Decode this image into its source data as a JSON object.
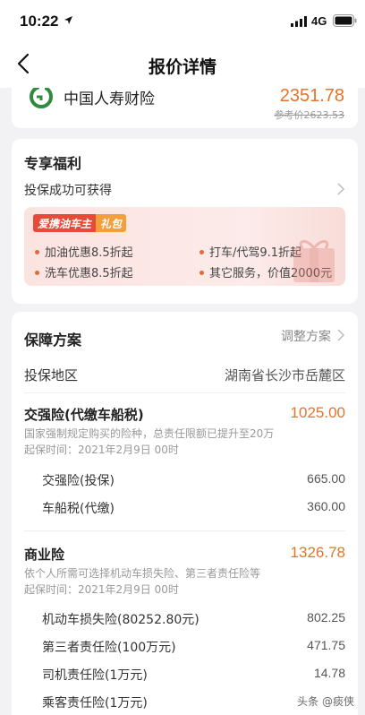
{
  "status_bar": {
    "time": "10:22",
    "network": "4G"
  },
  "nav": {
    "title": "报价详情"
  },
  "insurer": {
    "name": "中国人寿财险",
    "price": "2351.78",
    "reference_price": "参考价2623.53"
  },
  "benefits": {
    "title": "专享福利",
    "subtitle": "投保成功可获得",
    "banner": {
      "tag_main": "爱携油车主",
      "tag_sub": "礼包",
      "perks": [
        "加油优惠8.5折起",
        "打车/代驾9.1折起",
        "洗车优惠8.5折起",
        "其它服务，价值2000元"
      ]
    }
  },
  "plan": {
    "title": "保障方案",
    "adjust_label": "调整方案",
    "region_label": "投保地区",
    "region_value": "湖南省长沙市岳麓区",
    "compulsory": {
      "title": "交强险(代缴车船税)",
      "amount": "1025.00",
      "desc": "国家强制规定购买的险种，总责任限额已提升至20万",
      "start": "起保时间：2021年2月9日 00时",
      "items": [
        {
          "label": "交强险(投保)",
          "value": "665.00"
        },
        {
          "label": "车船税(代缴)",
          "value": "360.00"
        }
      ]
    },
    "commercial": {
      "title": "商业险",
      "amount": "1326.78",
      "desc": "依个人所需可选择机动车损失险、第三者责任险等",
      "start": "起保时间：2021年2月9日 00时",
      "items": [
        {
          "label": "机动车损失险(80252.80元)",
          "value": "802.25"
        },
        {
          "label": "第三者责任险(100万元)",
          "value": "471.75"
        },
        {
          "label": "司机责任险(1万元)",
          "value": "14.78"
        },
        {
          "label": "乘客责任险(1万元)",
          "value": ""
        }
      ]
    }
  },
  "watermark": "头条 @痰侠"
}
